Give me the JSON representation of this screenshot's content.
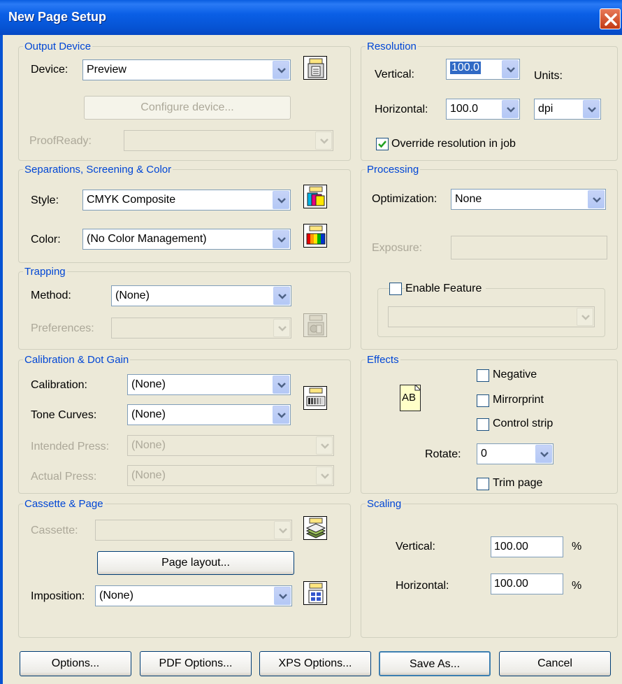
{
  "window": {
    "title": "New Page Setup"
  },
  "output_device": {
    "legend": "Output Device",
    "device_label": "Device:",
    "device_value": "Preview",
    "configure_button": "Configure device...",
    "proofready_label": "ProofReady:",
    "proofready_value": ""
  },
  "resolution": {
    "legend": "Resolution",
    "vertical_label": "Vertical:",
    "vertical_value": "100.0",
    "units_label": "Units:",
    "horizontal_label": "Horizontal:",
    "horizontal_value": "100.0",
    "units_value": "dpi",
    "override_label": "Override resolution in job",
    "override_checked": true
  },
  "separations": {
    "legend": "Separations, Screening & Color",
    "style_label": "Style:",
    "style_value": "CMYK Composite",
    "color_label": "Color:",
    "color_value": "(No Color Management)"
  },
  "processing": {
    "legend": "Processing",
    "optimization_label": "Optimization:",
    "optimization_value": "None",
    "exposure_label": "Exposure:",
    "exposure_value": "",
    "enable_feature_label": "Enable Feature",
    "enable_feature_checked": false,
    "feature_value": ""
  },
  "trapping": {
    "legend": "Trapping",
    "method_label": "Method:",
    "method_value": "(None)",
    "preferences_label": "Preferences:",
    "preferences_value": ""
  },
  "calibration": {
    "legend": "Calibration & Dot Gain",
    "calibration_label": "Calibration:",
    "calibration_value": "(None)",
    "tone_curves_label": "Tone Curves:",
    "tone_curves_value": "(None)",
    "intended_press_label": "Intended Press:",
    "intended_press_value": "(None)",
    "actual_press_label": "Actual Press:",
    "actual_press_value": "(None)"
  },
  "effects": {
    "legend": "Effects",
    "preview_text": "AB",
    "negative_label": "Negative",
    "mirrorprint_label": "Mirrorprint",
    "control_strip_label": "Control strip",
    "rotate_label": "Rotate:",
    "rotate_value": "0",
    "trim_page_label": "Trim page"
  },
  "cassette": {
    "legend": "Cassette & Page",
    "cassette_label": "Cassette:",
    "cassette_value": "",
    "page_layout_button": "Page layout...",
    "imposition_label": "Imposition:",
    "imposition_value": "(None)"
  },
  "scaling": {
    "legend": "Scaling",
    "vertical_label": "Vertical:",
    "vertical_value": "100.00",
    "vertical_unit": "%",
    "horizontal_label": "Horizontal:",
    "horizontal_value": "100.00",
    "horizontal_unit": "%"
  },
  "footer": {
    "options": "Options...",
    "pdf_options": "PDF Options...",
    "xps_options": "XPS Options...",
    "save_as": "Save As...",
    "cancel": "Cancel"
  },
  "colors": {
    "title_bar": "#0653d3",
    "dialog_bg": "#ece9d8",
    "legend_text": "#0046d5",
    "disabled_text": "#aca899"
  }
}
